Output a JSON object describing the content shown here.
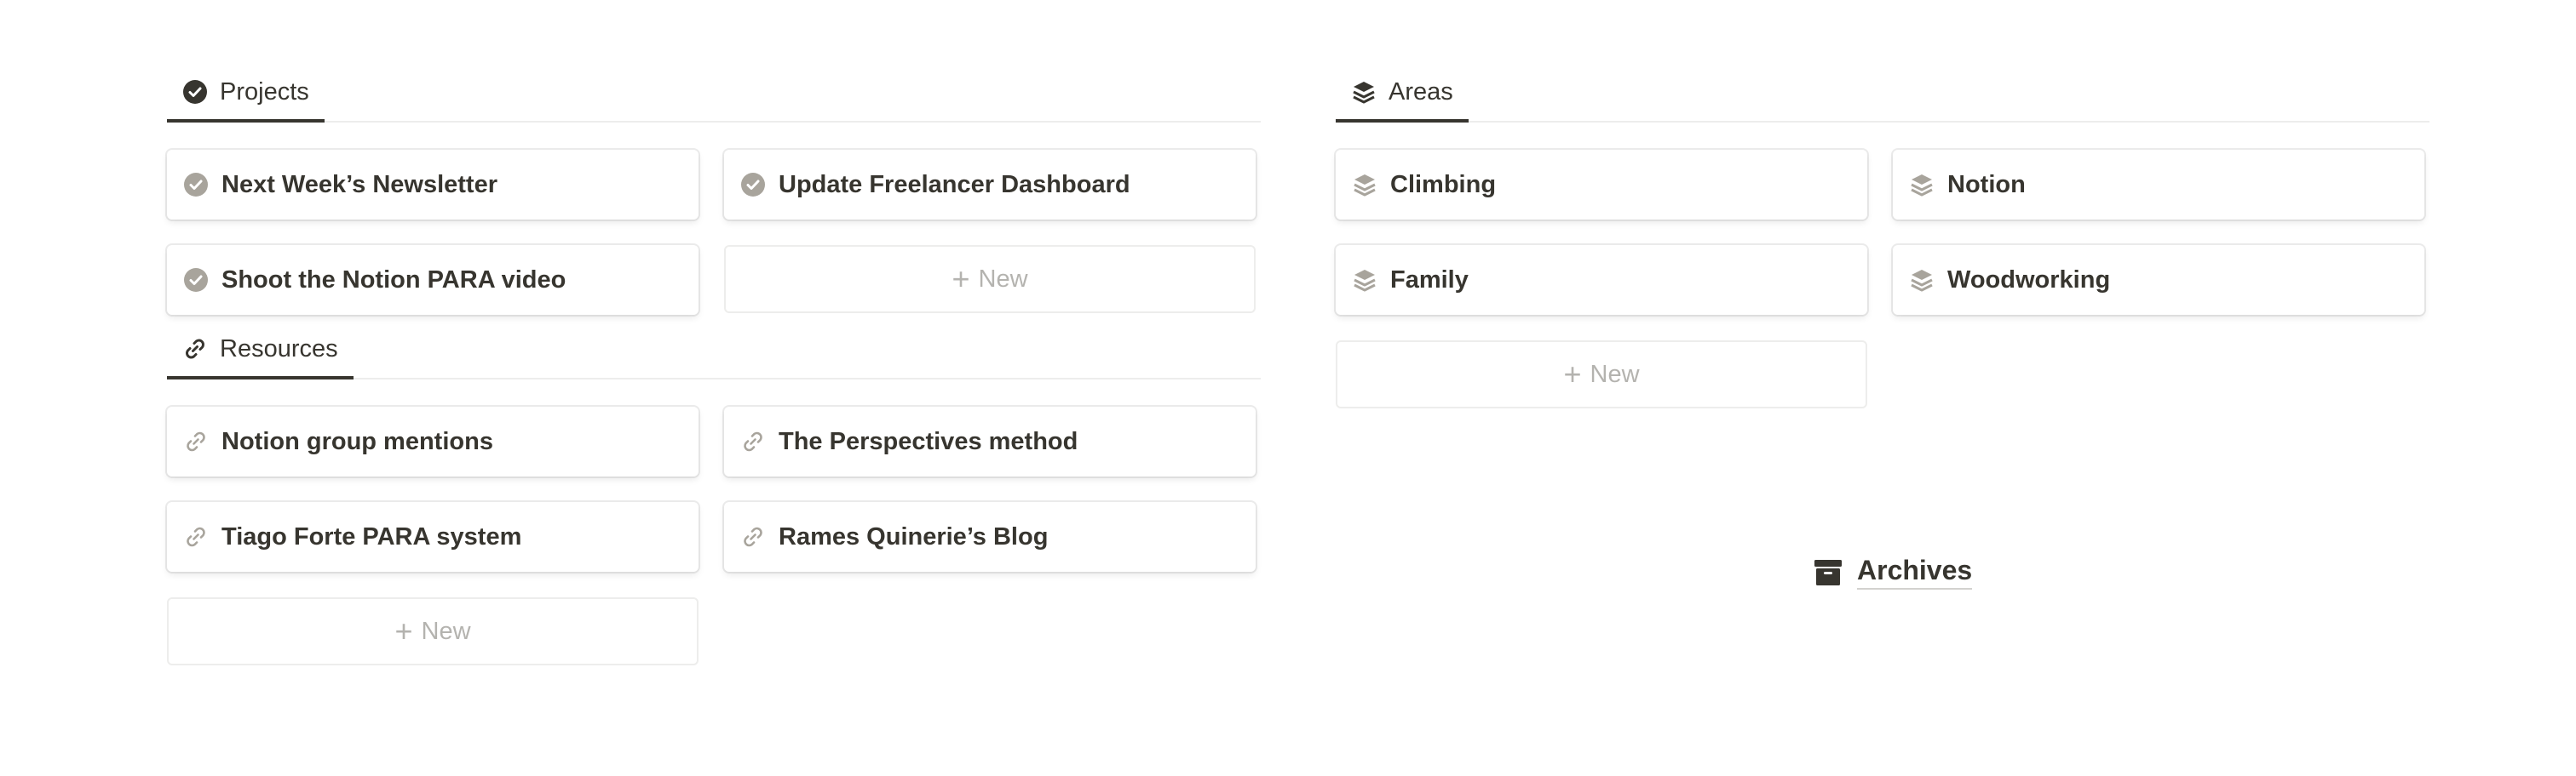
{
  "projects": {
    "tab_label": "Projects",
    "items": [
      "Next Week’s Newsletter",
      "Update Freelancer Dashboard",
      "Shoot the Notion PARA video"
    ],
    "new_label": "New"
  },
  "resources": {
    "tab_label": "Resources",
    "items": [
      "Notion group mentions",
      "The Perspectives method",
      "Tiago Forte PARA system",
      "Rames Quinerie’s Blog"
    ],
    "new_label": "New"
  },
  "areas": {
    "tab_label": "Areas",
    "items": [
      "Climbing",
      "Notion",
      "Family",
      "Woodworking"
    ],
    "new_label": "New"
  },
  "archives": {
    "label": "Archives"
  },
  "colors": {
    "text": "#37352f",
    "icon_muted": "#a8a49c",
    "new_text": "#b4b3af",
    "divider": "#ededec"
  }
}
